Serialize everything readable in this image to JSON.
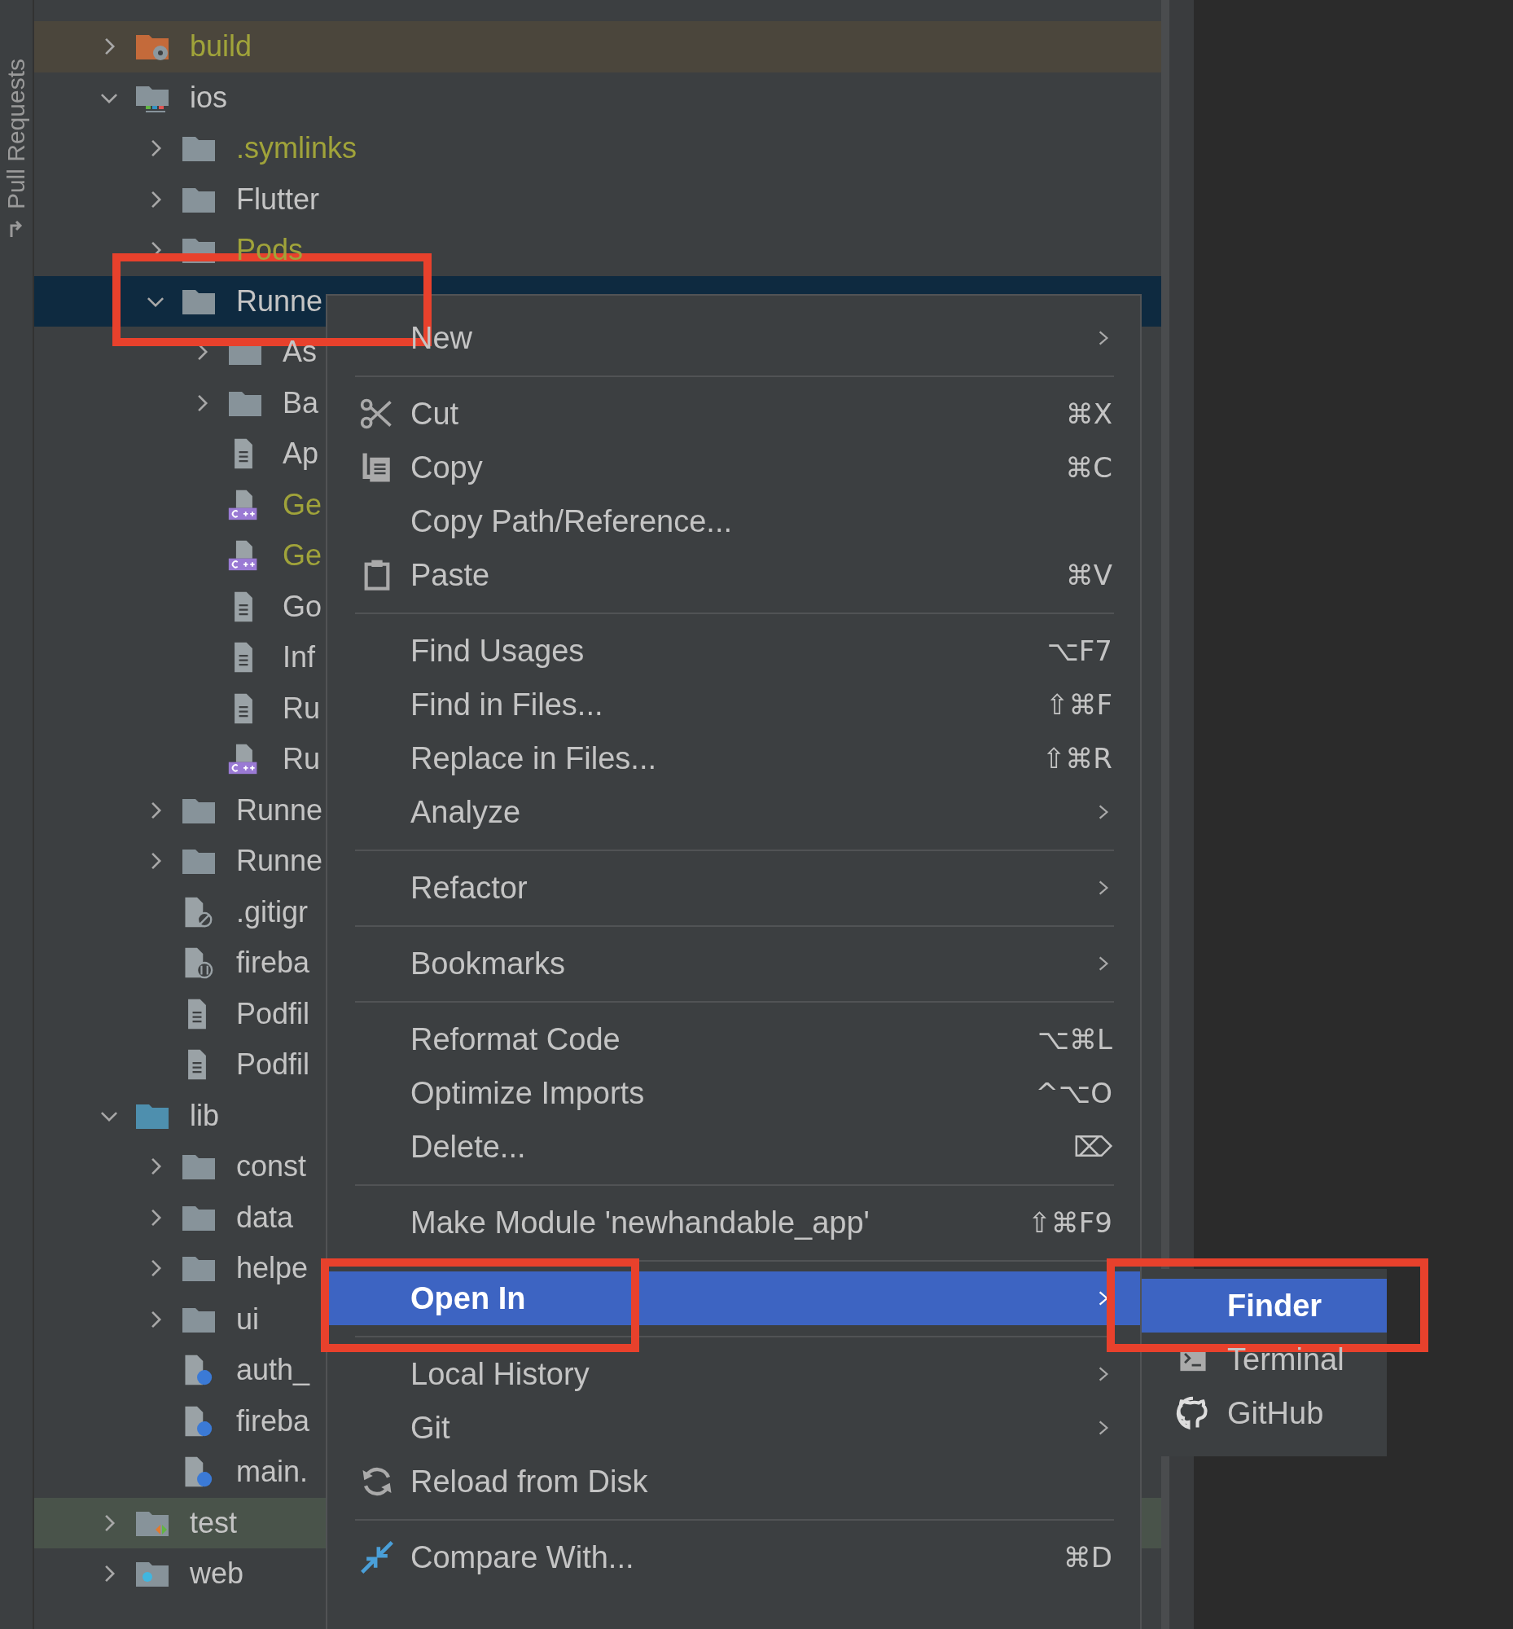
{
  "side_tab": {
    "label": "Pull Requests"
  },
  "tree": [
    {
      "label": "build",
      "kind": "excluded-folder",
      "expanded": false,
      "ignored": true,
      "selected": false
    },
    {
      "label": "ios",
      "kind": "module-folder",
      "expanded": true,
      "ignored": false,
      "selected": false,
      "children": [
        {
          "label": ".symlinks",
          "kind": "folder",
          "expanded": false,
          "ignored": true,
          "selected": false
        },
        {
          "label": "Flutter",
          "kind": "folder",
          "expanded": false,
          "ignored": false,
          "selected": false
        },
        {
          "label": "Pods",
          "kind": "folder",
          "expanded": false,
          "ignored": true,
          "selected": false
        },
        {
          "label": "Runne",
          "kind": "folder",
          "expanded": true,
          "ignored": false,
          "selected": true,
          "children": [
            {
              "label": "As",
              "kind": "folder",
              "expanded": false,
              "ignored": false,
              "selected": false
            },
            {
              "label": "Ba",
              "kind": "folder",
              "expanded": false,
              "ignored": false,
              "selected": false
            },
            {
              "label": "Ap",
              "kind": "file",
              "ignored": false,
              "selected": false
            },
            {
              "label": "Ge",
              "kind": "cpp-file",
              "ignored": true,
              "selected": false
            },
            {
              "label": "Ge",
              "kind": "cpp-file",
              "ignored": true,
              "selected": false
            },
            {
              "label": "Go",
              "kind": "file",
              "ignored": false,
              "selected": false
            },
            {
              "label": "Inf",
              "kind": "file",
              "ignored": false,
              "selected": false
            },
            {
              "label": "Ru",
              "kind": "file",
              "ignored": false,
              "selected": false
            },
            {
              "label": "Ru",
              "kind": "cpp-file",
              "ignored": false,
              "selected": false
            }
          ]
        },
        {
          "label": "Runne",
          "kind": "folder",
          "expanded": false,
          "ignored": false,
          "selected": false
        },
        {
          "label": "Runne",
          "kind": "folder",
          "expanded": false,
          "ignored": false,
          "selected": false
        },
        {
          "label": ".gitigr",
          "kind": "gitignore-file",
          "ignored": false,
          "selected": false
        },
        {
          "label": "fireba",
          "kind": "json-file",
          "ignored": false,
          "selected": false
        },
        {
          "label": "Podfil",
          "kind": "file",
          "ignored": false,
          "selected": false
        },
        {
          "label": "Podfil",
          "kind": "file",
          "ignored": false,
          "selected": false
        }
      ]
    },
    {
      "label": "lib",
      "kind": "source-folder",
      "expanded": true,
      "ignored": false,
      "selected": false,
      "children": [
        {
          "label": "const",
          "kind": "folder",
          "expanded": false,
          "ignored": false,
          "selected": false
        },
        {
          "label": "data",
          "kind": "folder",
          "expanded": false,
          "ignored": false,
          "selected": false
        },
        {
          "label": "helpe",
          "kind": "folder",
          "expanded": false,
          "ignored": false,
          "selected": false
        },
        {
          "label": "ui",
          "kind": "folder",
          "expanded": false,
          "ignored": false,
          "selected": false
        },
        {
          "label": "auth_",
          "kind": "dart-file",
          "ignored": false,
          "selected": false
        },
        {
          "label": "fireba",
          "kind": "dart-file",
          "ignored": false,
          "selected": false
        },
        {
          "label": "main.",
          "kind": "dart-file",
          "ignored": false,
          "selected": false
        }
      ]
    },
    {
      "label": "test",
      "kind": "test-folder",
      "expanded": false,
      "ignored": false,
      "selected": false
    },
    {
      "label": "web",
      "kind": "web-folder",
      "expanded": false,
      "ignored": false,
      "selected": false
    }
  ],
  "context_menu": {
    "groups": [
      [
        {
          "label": "New",
          "submenu": true,
          "selected": false
        }
      ],
      [
        {
          "label": "Cut",
          "shortcut": "⌘X",
          "submenu": false,
          "selected": false
        },
        {
          "label": "Copy",
          "shortcut": "⌘C",
          "submenu": false,
          "selected": false
        },
        {
          "label": "Copy Path/Reference...",
          "submenu": false,
          "selected": false
        },
        {
          "label": "Paste",
          "shortcut": "⌘V",
          "submenu": false,
          "selected": false
        }
      ],
      [
        {
          "label": "Find Usages",
          "shortcut": "⌥F7",
          "submenu": false,
          "selected": false
        },
        {
          "label": "Find in Files...",
          "shortcut": "⇧⌘F",
          "submenu": false,
          "selected": false
        },
        {
          "label": "Replace in Files...",
          "shortcut": "⇧⌘R",
          "submenu": false,
          "selected": false
        },
        {
          "label": "Analyze",
          "submenu": true,
          "selected": false
        }
      ],
      [
        {
          "label": "Refactor",
          "submenu": true,
          "selected": false
        }
      ],
      [
        {
          "label": "Bookmarks",
          "submenu": true,
          "selected": false
        }
      ],
      [
        {
          "label": "Reformat Code",
          "shortcut": "⌥⌘L",
          "submenu": false,
          "selected": false
        },
        {
          "label": "Optimize Imports",
          "shortcut": "^⌥O",
          "submenu": false,
          "selected": false
        },
        {
          "label": "Delete...",
          "shortcut": "⌦",
          "submenu": false,
          "selected": false
        }
      ],
      [
        {
          "label": "Make Module 'newhandable_app'",
          "shortcut": "⇧⌘F9",
          "submenu": false,
          "selected": false
        }
      ],
      [
        {
          "label": "Open In",
          "submenu": true,
          "selected": true
        }
      ],
      [
        {
          "label": "Local History",
          "submenu": true,
          "selected": false
        },
        {
          "label": "Git",
          "submenu": true,
          "selected": false
        },
        {
          "label": "Reload from Disk",
          "submenu": false,
          "selected": false
        }
      ],
      [
        {
          "label": "Compare With...",
          "shortcut": "⌘D",
          "submenu": false,
          "selected": false
        }
      ]
    ]
  },
  "submenu": {
    "items": [
      {
        "label": "Finder",
        "selected": true
      },
      {
        "label": "Terminal",
        "selected": false
      },
      {
        "label": "GitHub",
        "selected": false
      }
    ]
  }
}
